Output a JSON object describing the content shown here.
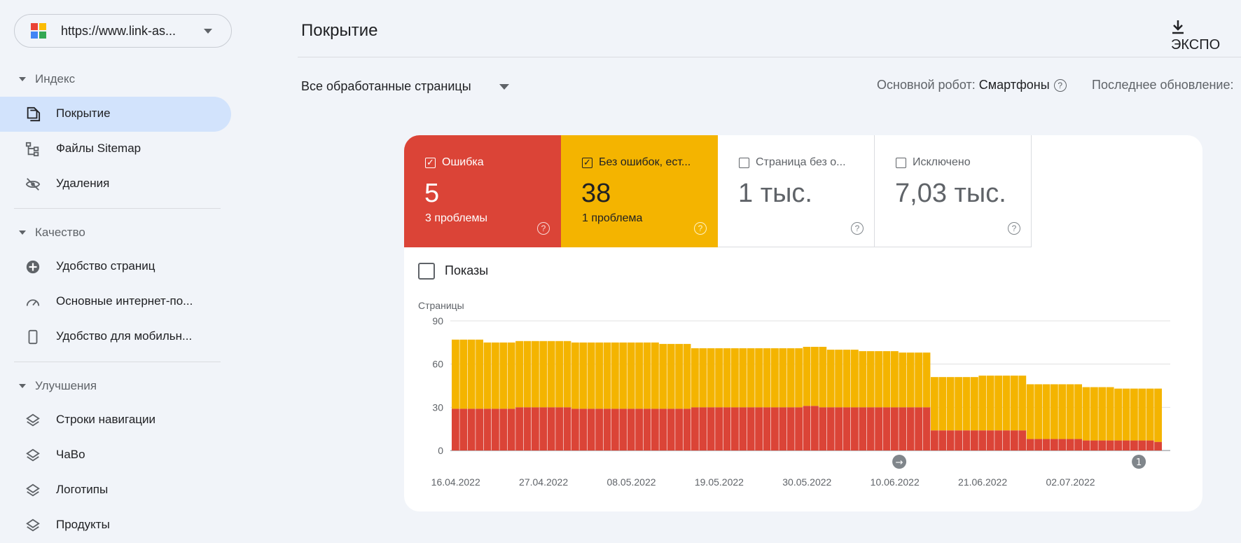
{
  "property": {
    "url": "https://www.link-as..."
  },
  "sidebar": {
    "sections": [
      {
        "label": "Индекс",
        "items": [
          {
            "label": "Покрытие",
            "icon": "pages-icon",
            "active": true
          },
          {
            "label": "Файлы Sitemap",
            "icon": "sitemap-icon"
          },
          {
            "label": "Удаления",
            "icon": "eye-off-icon"
          }
        ]
      },
      {
        "label": "Качество",
        "items": [
          {
            "label": "Удобство страниц",
            "icon": "page-experience-icon"
          },
          {
            "label": "Основные интернет-по...",
            "icon": "speedometer-icon"
          },
          {
            "label": "Удобство для мобильн...",
            "icon": "smartphone-icon"
          }
        ]
      },
      {
        "label": "Улучшения",
        "items": [
          {
            "label": "Строки навигации",
            "icon": "layers-icon"
          },
          {
            "label": "ЧаВо",
            "icon": "layers-icon"
          },
          {
            "label": "Логотипы",
            "icon": "layers-icon"
          },
          {
            "label": "Продукты",
            "icon": "layers-icon"
          }
        ]
      }
    ]
  },
  "header": {
    "title": "Покрытие",
    "export_label": "ЭКСПО",
    "filter_label": "Все обработанные страницы",
    "robot_label": "Основной робот:",
    "robot_value": "Смартфоны",
    "updated_label": "Последнее обновление:"
  },
  "tiles": [
    {
      "title": "Ошибка",
      "value": "5",
      "sub": "3 проблемы",
      "checked": true,
      "color": "#db4437"
    },
    {
      "title": "Без ошибок, ест...",
      "value": "38",
      "sub": "1 проблема",
      "checked": true,
      "color": "#f4b400"
    },
    {
      "title": "Страница без о...",
      "value": "1 тыс.",
      "sub": "",
      "checked": false,
      "color": "#ffffff"
    },
    {
      "title": "Исключено",
      "value": "7,03 тыс.",
      "sub": "",
      "checked": false,
      "color": "#ffffff"
    }
  ],
  "impressions_label": "Показы",
  "chart_data": {
    "type": "bar",
    "stacked": true,
    "ylabel": "Страницы",
    "ylim": [
      0,
      90
    ],
    "yticks": [
      0,
      30,
      60,
      90
    ],
    "x_tick_labels": [
      "16.04.2022",
      "27.04.2022",
      "08.05.2022",
      "19.05.2022",
      "30.05.2022",
      "10.06.2022",
      "21.06.2022",
      "02.07.2022"
    ],
    "annotations": [
      {
        "bar_index": 56,
        "label": "→"
      },
      {
        "bar_index": 86,
        "label": "1"
      }
    ],
    "series": [
      {
        "name": "Ошибка",
        "color": "#db4437",
        "values": [
          29,
          29,
          29,
          29,
          29,
          29,
          29,
          29,
          30,
          30,
          30,
          30,
          30,
          30,
          30,
          29,
          29,
          29,
          29,
          29,
          29,
          29,
          29,
          29,
          29,
          29,
          29,
          29,
          29,
          29,
          30,
          30,
          30,
          30,
          30,
          30,
          30,
          30,
          30,
          30,
          30,
          30,
          30,
          30,
          31,
          31,
          30,
          30,
          30,
          30,
          30,
          30,
          30,
          30,
          30,
          30,
          30,
          30,
          30,
          30,
          14,
          14,
          14,
          14,
          14,
          14,
          14,
          14,
          14,
          14,
          14,
          14,
          8,
          8,
          8,
          8,
          8,
          8,
          8,
          7,
          7,
          7,
          7,
          7,
          7,
          7,
          7,
          7,
          6
        ]
      },
      {
        "name": "Без ошибок, ест...",
        "color": "#f4b400",
        "values": [
          48,
          48,
          48,
          48,
          46,
          46,
          46,
          46,
          46,
          46,
          46,
          46,
          46,
          46,
          46,
          46,
          46,
          46,
          46,
          46,
          46,
          46,
          46,
          46,
          46,
          46,
          45,
          45,
          45,
          45,
          41,
          41,
          41,
          41,
          41,
          41,
          41,
          41,
          41,
          41,
          41,
          41,
          41,
          41,
          41,
          41,
          42,
          40,
          40,
          40,
          40,
          39,
          39,
          39,
          39,
          39,
          38,
          38,
          38,
          38,
          37,
          37,
          37,
          37,
          37,
          37,
          38,
          38,
          38,
          38,
          38,
          38,
          38,
          38,
          38,
          38,
          38,
          38,
          38,
          37,
          37,
          37,
          37,
          36,
          36,
          36,
          36,
          36,
          37
        ]
      }
    ]
  }
}
